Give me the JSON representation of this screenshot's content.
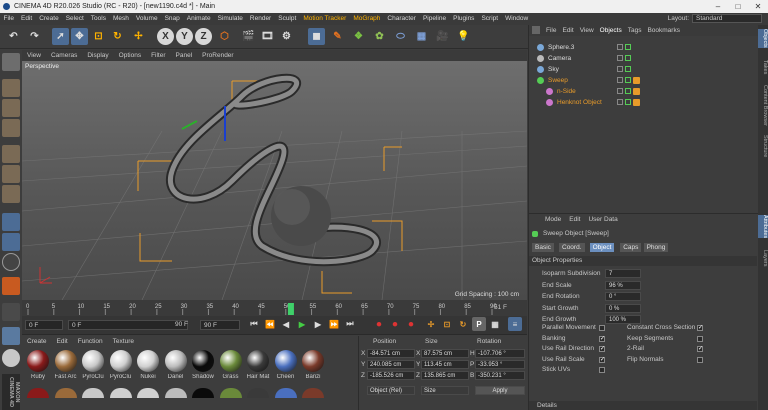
{
  "window": {
    "title": "CINEMA 4D R20.026 Studio (RC - R20) - [new1190.c4d *] - Main"
  },
  "menu": {
    "items": [
      "File",
      "Edit",
      "Create",
      "Select",
      "Tools",
      "Mesh",
      "Volume",
      "Snap",
      "Animate",
      "Simulate",
      "Render",
      "Sculpt"
    ],
    "highlight_items": [
      "Motion Tracker",
      "MoGraph"
    ],
    "items2": [
      "Character",
      "Pipeline",
      "Plugins",
      "Script",
      "Window"
    ],
    "layout_label": "Layout:",
    "layout_value": "Standard"
  },
  "toolbar": {
    "axis_x": "X",
    "axis_y": "Y",
    "axis_z": "Z"
  },
  "viewport": {
    "menu": [
      "View",
      "Cameras",
      "Display",
      "Options",
      "Filter",
      "Panel",
      "ProRender"
    ],
    "label": "Perspective",
    "grid_spacing": "Grid Spacing : 100 cm"
  },
  "timeline": {
    "ticks": [
      "0",
      "5",
      "10",
      "15",
      "20",
      "25",
      "30",
      "35",
      "40",
      "45",
      "50",
      "55",
      "60",
      "65",
      "70",
      "75",
      "80",
      "85",
      "90"
    ],
    "end_label": "51 F",
    "current": 51
  },
  "controls": {
    "start": "0 F",
    "current": "0 F",
    "end": "90 F",
    "end2": "90 F"
  },
  "materials": {
    "menu": [
      "Create",
      "Edit",
      "Function",
      "Texture"
    ],
    "items": [
      {
        "label": "Ruby",
        "color": "#8a1a1a"
      },
      {
        "label": "Fast Arc",
        "color": "#9a6a3a"
      },
      {
        "label": "PyroClu",
        "color": "#c8c8c8"
      },
      {
        "label": "PyroClu",
        "color": "#cfcfcf"
      },
      {
        "label": "Nukei",
        "color": "#d0d0d0"
      },
      {
        "label": "Danel",
        "color": "#bcbcbc"
      },
      {
        "label": "Shadow",
        "color": "#0a0a0a"
      },
      {
        "label": "Grass",
        "color": "#6a8a3a"
      },
      {
        "label": "Hair Mat",
        "color": "#3a3a3a"
      },
      {
        "label": "Cheen",
        "color": "#4a6fbf"
      },
      {
        "label": "Banzi",
        "color": "#7a3a2a"
      }
    ]
  },
  "coords": {
    "headers": [
      "Position",
      "Size",
      "Rotation"
    ],
    "rows": [
      {
        "axis": "X",
        "pos": "-84.571 cm",
        "size": "87.575 cm",
        "rlabel": "H",
        "rot": "-107.706 °"
      },
      {
        "axis": "Y",
        "pos": "240.085 cm",
        "size": "113.45 cm",
        "rlabel": "P",
        "rot": "-33.953 °"
      },
      {
        "axis": "Z",
        "pos": "-185.526 cm",
        "size": "135.865 cm",
        "rlabel": "B",
        "rot": "-350.231 °"
      }
    ],
    "mode": "Object (Rel)",
    "size_mode": "Size",
    "apply": "Apply"
  },
  "objects": {
    "menu": [
      "File",
      "Edit",
      "View",
      "Objects",
      "Tags",
      "Bookmarks"
    ],
    "items": [
      {
        "name": "Sphere.3",
        "color": "#7aa8d8",
        "indent": 0,
        "orange": false
      },
      {
        "name": "Camera",
        "color": "#bbbbbb",
        "indent": 0,
        "orange": false
      },
      {
        "name": "Sky",
        "color": "#7aa8d8",
        "indent": 0,
        "orange": false
      },
      {
        "name": "Sweep",
        "color": "#55cc55",
        "indent": 0,
        "orange": true
      },
      {
        "name": "n-Side",
        "color": "#cc77cc",
        "indent": 1,
        "orange": true
      },
      {
        "name": "Henknot Object",
        "color": "#cc77cc",
        "indent": 1,
        "orange": true
      }
    ]
  },
  "attributes": {
    "menu": [
      "Mode",
      "Edit",
      "User Data"
    ],
    "title": "Sweep Object [Sweep]",
    "tabs": [
      "Basic",
      "Coord.",
      "Object",
      "Caps",
      "Phong"
    ],
    "active_tab": "Object",
    "section": "Object Properties",
    "fields": [
      {
        "label": "Isoparm Subdivision",
        "value": "7"
      },
      {
        "label": "End Scale",
        "value": "96 %"
      },
      {
        "label": "End Rotation",
        "value": "0 °"
      },
      {
        "label": "Start Growth",
        "value": "0 %"
      },
      {
        "label": "End Growth",
        "value": "100 %"
      }
    ],
    "checks_left": [
      {
        "label": "Parallel Movement",
        "checked": false
      },
      {
        "label": "Banking",
        "checked": true
      },
      {
        "label": "Use Rail Direction",
        "checked": true
      },
      {
        "label": "Use Rail Scale",
        "checked": true
      },
      {
        "label": "Stick UVs",
        "checked": false
      }
    ],
    "checks_right": [
      {
        "label": "Constant Cross Section",
        "checked": true
      },
      {
        "label": "Keep Segments",
        "checked": false
      },
      {
        "label": "2-Rail",
        "checked": true
      },
      {
        "label": "Flip Normals",
        "checked": false
      }
    ],
    "details": "Details"
  },
  "sidetabs": [
    "Objects",
    "Takes",
    "Content Browser",
    "Structure",
    "Attributes",
    "Layers"
  ]
}
